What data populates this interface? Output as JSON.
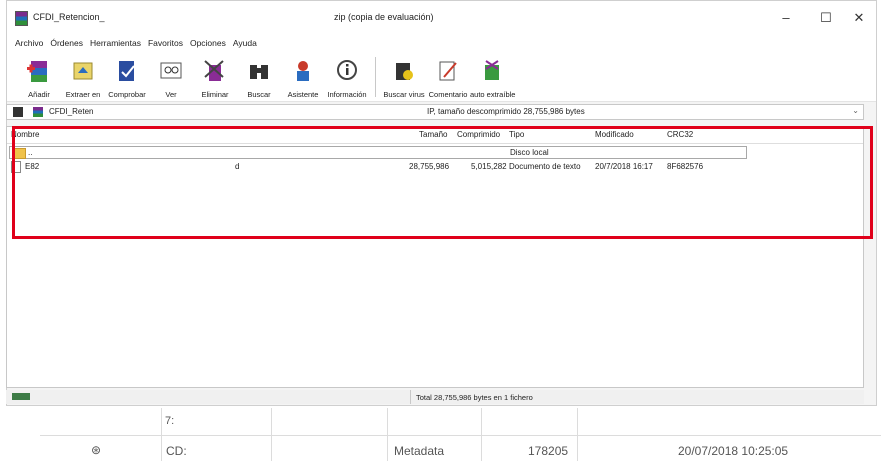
{
  "window": {
    "title_left": "CFDI_Retencion_",
    "title_center": "zip (copia de evaluación)",
    "controls": {
      "minimize": "–",
      "maximize": "☐",
      "close": "✕"
    }
  },
  "menu": [
    "Archivo",
    "Órdenes",
    "Herramientas",
    "Favoritos",
    "Opciones",
    "Ayuda"
  ],
  "toolbar": [
    {
      "label": "Añadir",
      "icon": "add-archive-icon"
    },
    {
      "label": "Extraer en",
      "icon": "extract-icon"
    },
    {
      "label": "Comprobar",
      "icon": "test-icon"
    },
    {
      "label": "Ver",
      "icon": "view-icon"
    },
    {
      "label": "Eliminar",
      "icon": "delete-icon"
    },
    {
      "label": "Buscar",
      "icon": "find-icon"
    },
    {
      "label": "Asistente",
      "icon": "wizard-icon"
    },
    {
      "label": "Información",
      "icon": "info-icon"
    },
    {
      "label": "Buscar virus",
      "icon": "virus-scan-icon"
    },
    {
      "label": "Comentario",
      "icon": "comment-icon"
    },
    {
      "label": "auto extraíble",
      "icon": "sfx-icon"
    }
  ],
  "pathbar": {
    "path": "CFDI_Reten",
    "info": "IP, tamaño descomprimido 28,755,986 bytes",
    "dropdown": "⌄"
  },
  "columns": {
    "name": "Nombre",
    "size": "Tamaño",
    "packed": "Comprimido",
    "type": "Tipo",
    "modified": "Modificado",
    "crc": "CRC32"
  },
  "rows": {
    "parent": {
      "name": "..",
      "type": "Disco local"
    },
    "file": {
      "name": "E82",
      "suffix": "d",
      "size": "28,755,986",
      "packed": "5,015,282",
      "type": "Documento de texto",
      "modified": "20/7/2018 16:17",
      "crc": "8F682576"
    }
  },
  "status": {
    "text": "Total 28,755,986 bytes en 1 fichero"
  },
  "background": {
    "cell_partial": "7:",
    "row": {
      "icon_glyph": "⊛",
      "id": "CD:",
      "type": "Metadata",
      "size": "178205",
      "date": "20/07/2018 10:25:05"
    }
  },
  "colors": {
    "highlight": "#e0001a",
    "folder": "#f0c24a"
  }
}
